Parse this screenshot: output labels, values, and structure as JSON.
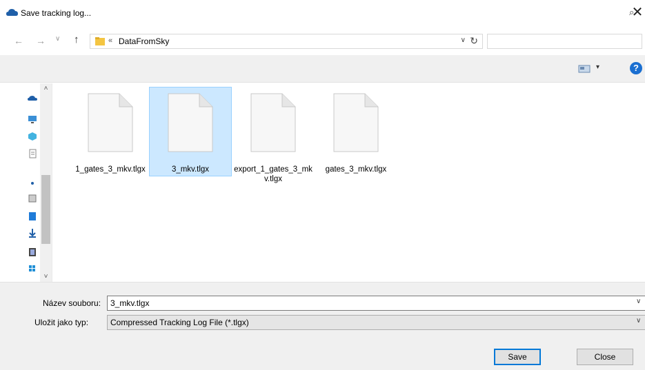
{
  "window": {
    "title": "Save tracking log...",
    "close_label": "✕"
  },
  "navigation": {
    "back_label": "←",
    "forward_label": "→",
    "recent_label": "∨",
    "up_label": "↑",
    "breadcrumb_separator": "«",
    "current_folder": "DataFromSky",
    "dropdown_label": "∨",
    "refresh_label": "↻",
    "search_placeholder": "",
    "search_icon_label": "⌕"
  },
  "toolbar": {
    "view_dropdown_label": "▾",
    "help_label": "?"
  },
  "nav_pane": {
    "scroll_up_label": "˄",
    "scroll_down_label": "˅"
  },
  "files": [
    {
      "name": "1_gates_3_mkv.tlgx",
      "selected": false
    },
    {
      "name": "3_mkv.tlgx",
      "selected": true
    },
    {
      "name": "export_1_gates_3_mkv.tlgx",
      "selected": false
    },
    {
      "name": "gates_3_mkv.tlgx",
      "selected": false
    }
  ],
  "footer": {
    "filename_label": "Název souboru:",
    "filename_value": "3_mkv.tlgx",
    "filetype_label": "Uložit jako typ:",
    "filetype_value": "Compressed Tracking Log File (*.tlgx)",
    "dropdown_label": "∨",
    "save_label": "Save",
    "close_label": "Close"
  },
  "colors": {
    "selection_fill": "#cce8ff",
    "selection_border": "#99d1ff",
    "accent": "#0078d7",
    "folder": "#f4c542"
  }
}
